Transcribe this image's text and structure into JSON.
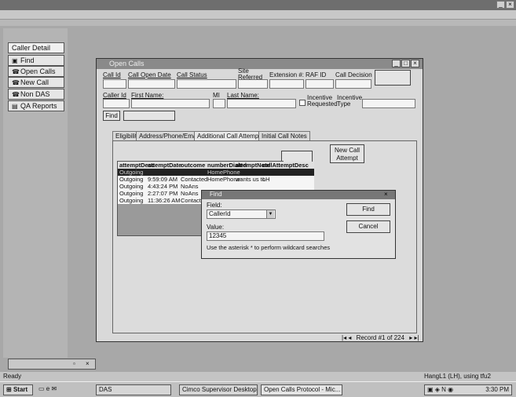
{
  "nav": {
    "caller_detail": "Caller Detail",
    "items": [
      {
        "label": "Find",
        "icon": "binoculars-icon"
      },
      {
        "label": "Open Calls",
        "icon": "phone-icon"
      },
      {
        "label": "New Call",
        "icon": "phone-icon"
      },
      {
        "label": "Non DAS",
        "icon": "phone-icon"
      },
      {
        "label": "QA Reports",
        "icon": "report-icon"
      }
    ]
  },
  "dialog": {
    "title": "Open Calls",
    "labels": {
      "call_id": "Call Id",
      "call_open_date": "Call Open Date",
      "call_status": "Call Status",
      "site_referred": "Site Referred to:",
      "extension": "Extension #:",
      "raf_id": "RAF ID",
      "call_decision": "Call Decision",
      "caller_id": "Caller Id",
      "first_name": "First Name:",
      "mi": "MI",
      "last_name": "Last Name:",
      "incentive_requested": "Incentive Requested",
      "incentive_type": "Incentive Type"
    },
    "find_button": "Find",
    "new_call_attempt_button": "New Call Attempt",
    "tabs": [
      "Eligibility",
      "Address/Phone/Email",
      "Additional Call Attempts",
      "Initial Call Notes"
    ],
    "grid": {
      "headers": [
        "attemptDesc",
        "attemptDate",
        "outcome",
        "numberDialed",
        "attemptNote",
        "callAttemptDesc"
      ],
      "rows": [
        [
          "Outgoing",
          "",
          "",
          "HomePhone",
          "",
          ""
        ],
        [
          "Outgoing",
          "9:59:09 AM",
          "Contacted",
          "HomePhone",
          "wants us to",
          "LH"
        ],
        [
          "Outgoing",
          "4:43:24 PM",
          "NoAns",
          "",
          "",
          ""
        ],
        [
          "Outgoing",
          "2:27:07 PM",
          "NoAns",
          "",
          "",
          ""
        ],
        [
          "Outgoing",
          "11:36:26 AM",
          "Contact",
          "",
          "",
          ""
        ]
      ]
    },
    "record_nav": "Record #1 of 224"
  },
  "find_dialog": {
    "title": "Find",
    "field_label": "Field:",
    "field_value": "CallerId",
    "value_label": "Value:",
    "value_text": "12345",
    "hint": "Use the asterisk * to perform wildcard searches",
    "find_button": "Find",
    "cancel_button": "Cancel"
  },
  "status": {
    "left": "Ready",
    "right": "HangL1 (LH), using tfu2"
  },
  "taskbar": {
    "start": "Start",
    "buttons": [
      "DAS",
      "Cimco Supervisor Desktop",
      "Open Calls Protocol - Mic..."
    ],
    "clock": "3:30 PM"
  }
}
